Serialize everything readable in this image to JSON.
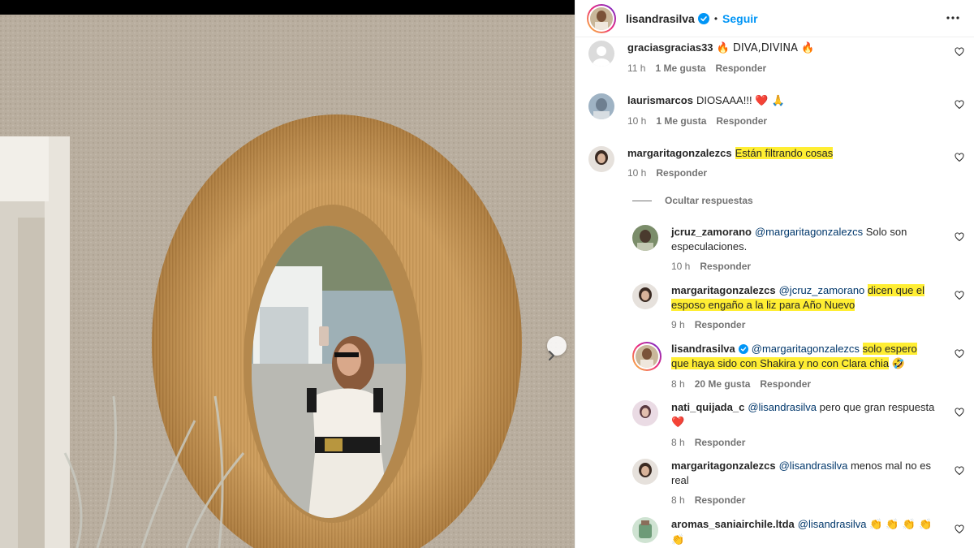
{
  "post": {
    "author": "lisandrasilva",
    "dot": "•",
    "follow_label": "Seguir"
  },
  "comments": [
    {
      "username": "graciasgracias33",
      "text_pre": "🔥 DIVA,DIVINA 🔥",
      "time": "11 h",
      "likes": "1 Me gusta",
      "reply": "Responder"
    },
    {
      "username": "laurismarcos",
      "text_pre": "DIOSAAA!!! ",
      "emoji": "❤️ 🙏",
      "time": "10 h",
      "likes": "1 Me gusta",
      "reply": "Responder"
    },
    {
      "username": "margaritagonzalezcs",
      "text_hl": "Están filtrando cosas",
      "time": "10 h",
      "reply": "Responder"
    }
  ],
  "hide_replies_label": "Ocultar respuestas",
  "replies": [
    {
      "username": "jcruz_zamorano",
      "mention": "@margaritagonzalezcs",
      "text": "Solo son especulaciones.",
      "time": "10 h",
      "reply": "Responder"
    },
    {
      "username": "margaritagonzalezcs",
      "mention": "@jcruz_zamorano",
      "text_hl": "dicen que el esposo engaño a la liz para Año Nuevo",
      "time": "9 h",
      "reply": "Responder"
    },
    {
      "username": "lisandrasilva",
      "mention": "@margaritagonzalezcs",
      "text_hl": "solo espero que haya sido con Shakira y no con Clara chia",
      "emoji": "🤣",
      "time": "8 h",
      "likes": "20 Me gusta",
      "reply": "Responder"
    },
    {
      "username": "nati_quijada_c",
      "mention": "@lisandrasilva",
      "text": "pero que gran respuesta",
      "emoji": "❤️",
      "time": "8 h",
      "reply": "Responder"
    },
    {
      "username": "margaritagonzalezcs",
      "mention": "@lisandrasilva",
      "text": "menos mal no es real",
      "time": "8 h",
      "reply": "Responder"
    },
    {
      "username": "aromas_saniairchile.ltda",
      "mention": "@lisandrasilva",
      "emoji": "👏 👏 👏 👏 👏"
    }
  ],
  "colors": {
    "accent": "#0095f6",
    "highlight": "#ffee33",
    "heart": "#ed4956",
    "verified": "#0095f6"
  },
  "icons": [
    "verified-badge-icon",
    "more-options-icon",
    "heart-outline-icon",
    "chevron-right-icon"
  ]
}
